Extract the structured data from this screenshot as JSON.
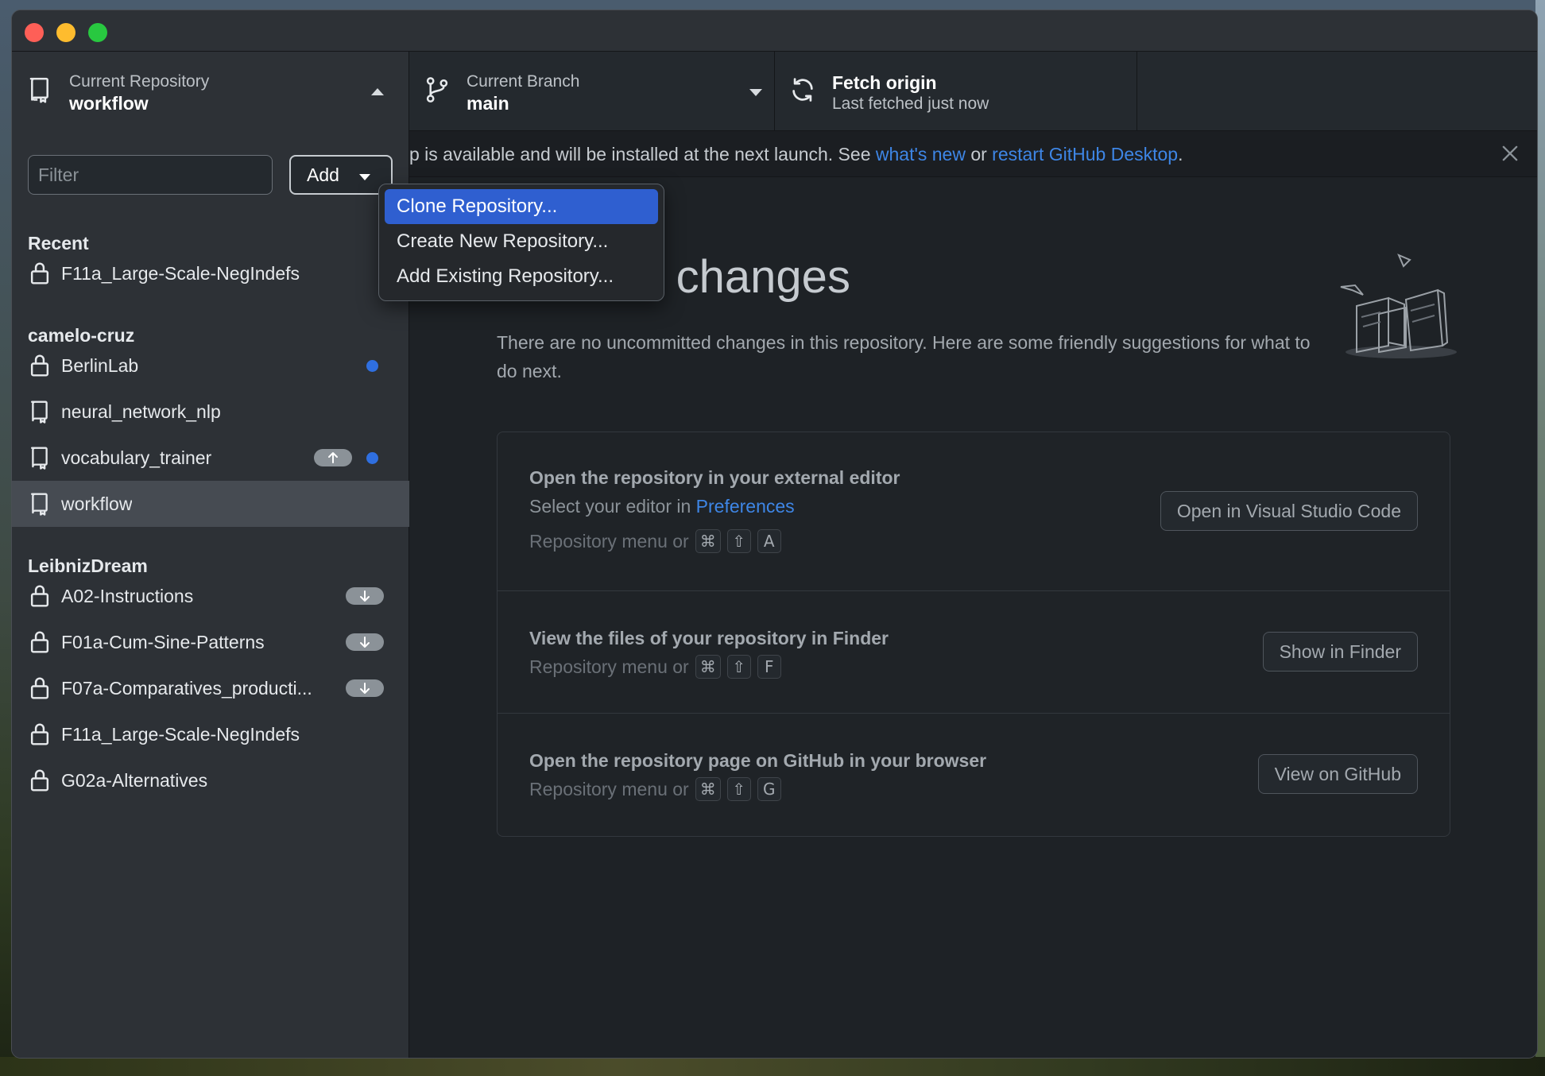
{
  "toolbar": {
    "repo_label": "Current Repository",
    "repo_value": "workflow",
    "branch_label": "Current Branch",
    "branch_value": "main",
    "fetch_label": "Fetch origin",
    "fetch_value": "Last fetched just now"
  },
  "sidebar": {
    "filter_placeholder": "Filter",
    "add_label": "Add",
    "groups": [
      {
        "title": "Recent"
      },
      {
        "title": "camelo-cruz"
      },
      {
        "title": "LeibnizDream"
      }
    ],
    "items": [
      {
        "name": "F11a_Large-Scale-NegIndefs",
        "icon": "lock-icon"
      },
      {
        "name": "BerlinLab",
        "icon": "lock-icon",
        "changes_dot": true
      },
      {
        "name": "neural_network_nlp",
        "icon": "repo-icon"
      },
      {
        "name": "vocabulary_trainer",
        "icon": "repo-icon",
        "badge": "ahead-arrow-up",
        "changes_dot": true
      },
      {
        "name": "workflow",
        "icon": "repo-icon",
        "selected": true
      },
      {
        "name": "A02-Instructions",
        "icon": "lock-icon",
        "badge": "behind-arrow-down"
      },
      {
        "name": "F01a-Cum-Sine-Patterns",
        "icon": "lock-icon",
        "badge": "behind-arrow-down"
      },
      {
        "name": "F07a-Comparatives_producti...",
        "icon": "lock-icon",
        "badge": "behind-arrow-down"
      },
      {
        "name": "F11a_Large-Scale-NegIndefs",
        "icon": "lock-icon"
      },
      {
        "name": "G02a-Alternatives",
        "icon": "lock-icon"
      }
    ]
  },
  "menu": {
    "items": [
      {
        "label": "Clone Repository..."
      },
      {
        "label": "Create New Repository..."
      },
      {
        "label": "Add Existing Repository..."
      }
    ]
  },
  "banner": {
    "text_prefix": "p is available and will be installed at the next launch. See ",
    "link1": "what's new",
    "text_mid": " or ",
    "link2": "restart GitHub Desktop",
    "text_suffix": "."
  },
  "main": {
    "title": "No local changes",
    "description": "There are no uncommitted changes in this repository. Here are some friendly suggestions for what to do next.",
    "cards": [
      {
        "title": "Open the repository in your external editor",
        "desc_prefix": "Select your editor in ",
        "desc_link": "Preferences",
        "hint": "Repository menu or",
        "keys": [
          "⌘",
          "⇧",
          "A"
        ],
        "button": "Open in Visual Studio Code"
      },
      {
        "title": "View the files of your repository in Finder",
        "hint": "Repository menu or",
        "keys": [
          "⌘",
          "⇧",
          "F"
        ],
        "button": "Show in Finder"
      },
      {
        "title": "Open the repository page on GitHub in your browser",
        "hint": "Repository menu or",
        "keys": [
          "⌘",
          "⇧",
          "G"
        ],
        "button": "View on GitHub"
      }
    ]
  },
  "colors": {
    "accent": "#2f6fe0",
    "link": "#3e86e6",
    "menu_highlight": "#2f5fd0",
    "window_bg": "#24292e"
  }
}
